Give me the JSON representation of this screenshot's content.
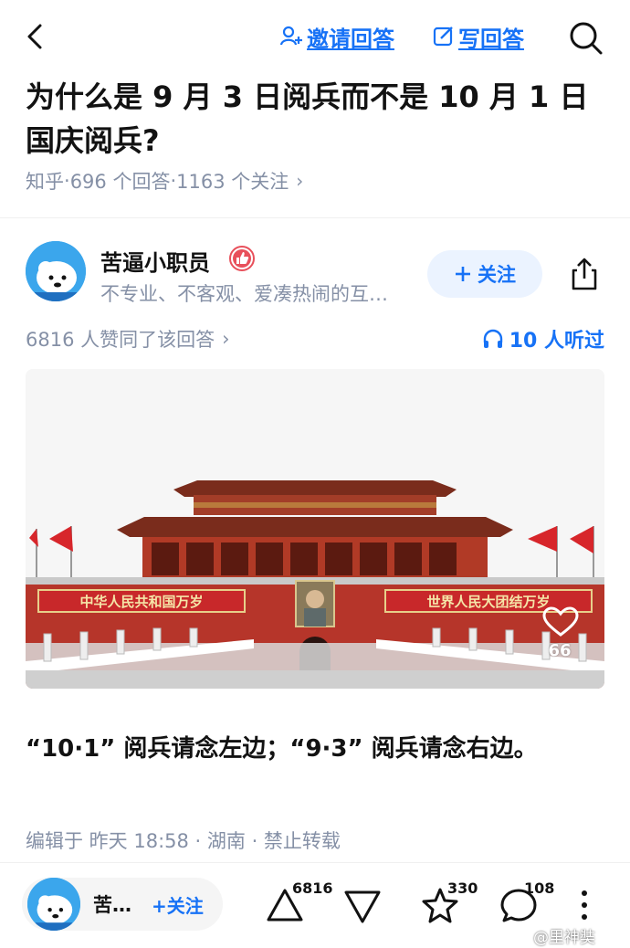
{
  "topbar": {
    "invite_label": "邀请回答",
    "write_label": "写回答"
  },
  "question": {
    "title": "为什么是 9 月 3 日阅兵而不是 10 月 1 日国庆阅兵?",
    "source": "知乎",
    "sep": " · ",
    "answers": "696 个回答",
    "followers": "1163 个关注"
  },
  "author": {
    "name": "苦逼小职员",
    "bio": "不专业、不客观、爱凑热闹的互…",
    "follow_label": "关注"
  },
  "answer": {
    "agree_text": "6816 人赞同了该回答",
    "listen_text": "10 人听过",
    "image_like_count": "66",
    "banner_left": "中华人民共和国万岁",
    "banner_right": "世界人民大团结万岁",
    "body": "“10·1” 阅兵请念左边；“9·3” 阅兵请念右边。",
    "edit_meta": "编辑于 昨天 18:58 · 湖南 · 禁止转载"
  },
  "bottom": {
    "author_short": "苦…",
    "follow_label": "+关注",
    "upvote_count": "6816",
    "favorite_count": "330",
    "comment_count": "108"
  },
  "watermark": "@里神奘",
  "colors": {
    "accent": "#1772f6",
    "muted": "#8590a6",
    "text": "#121212"
  }
}
